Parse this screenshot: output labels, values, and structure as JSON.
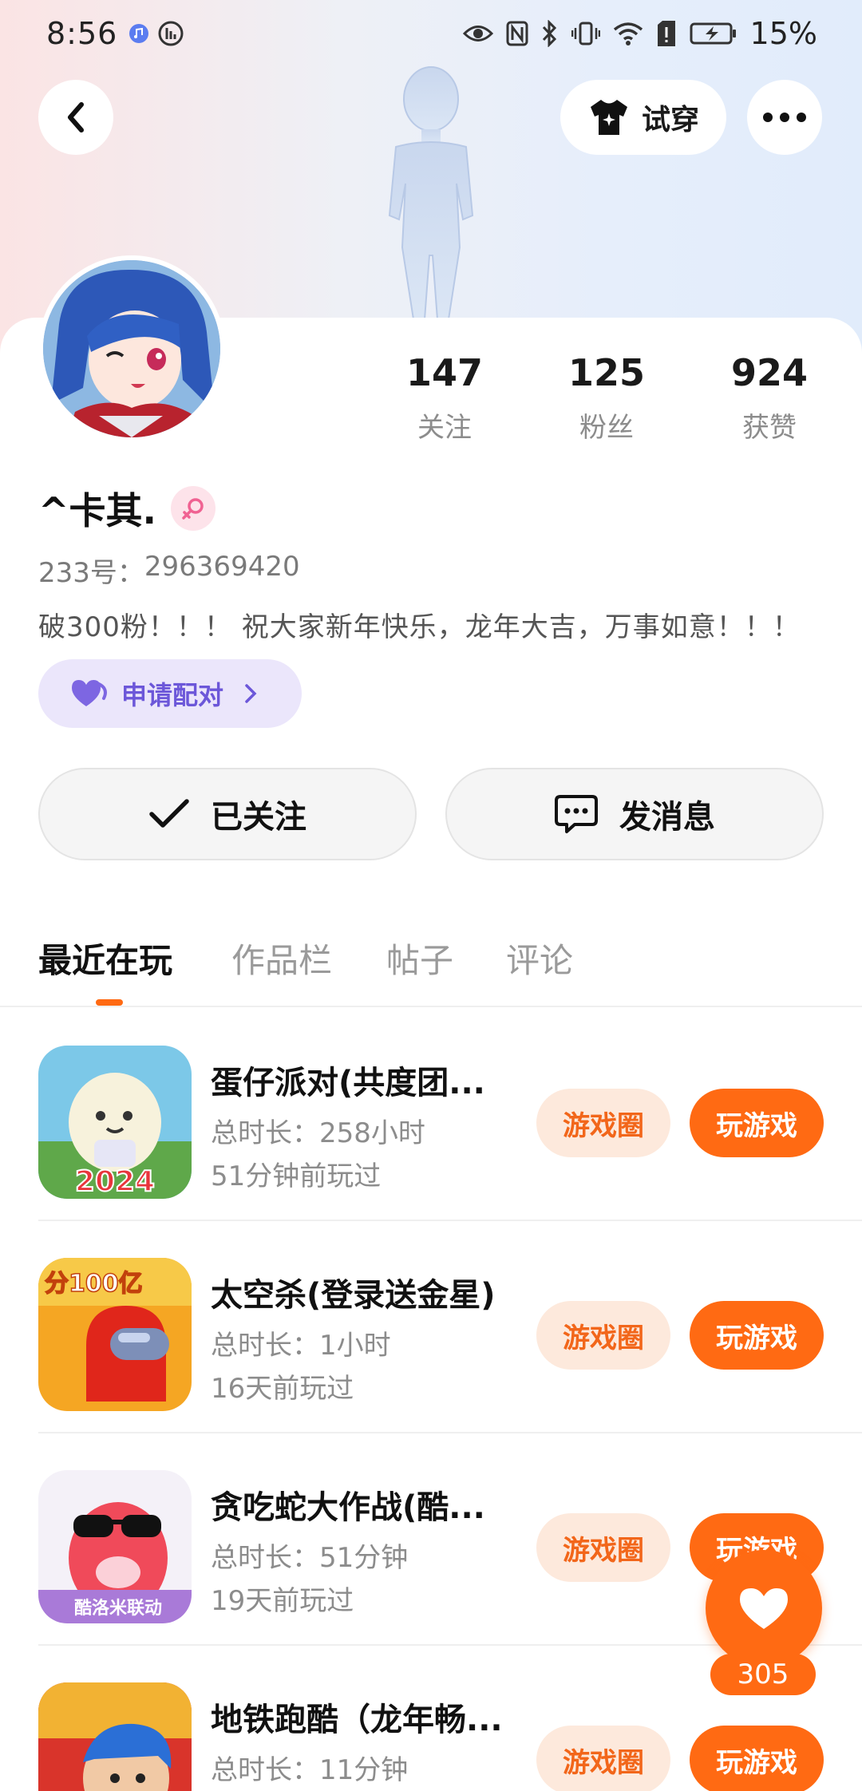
{
  "status_bar": {
    "time": "8:56",
    "battery": "15%"
  },
  "nav": {
    "try_on_label": "试穿"
  },
  "profile": {
    "stats": [
      {
        "num": "147",
        "label": "关注"
      },
      {
        "num": "125",
        "label": "粉丝"
      },
      {
        "num": "924",
        "label": "获赞"
      }
    ],
    "nickname": "^卡其.",
    "uid_label": "233号：",
    "uid": "296369420",
    "bio": "破300粉！！！ 祝大家新年快乐，龙年大吉，万事如意！！！",
    "pair_label": "申请配对"
  },
  "actions": {
    "follow_label": "已关注",
    "message_label": "发消息"
  },
  "tabs": [
    {
      "label": "最近在玩"
    },
    {
      "label": "作品栏"
    },
    {
      "label": "帖子"
    },
    {
      "label": "评论"
    }
  ],
  "games": [
    {
      "name": "蛋仔派对(共度团...",
      "duration": "总时长：258小时",
      "last_played": "51分钟前玩过",
      "circle_label": "游戏圈",
      "play_label": "玩游戏"
    },
    {
      "name": "太空杀(登录送金星)",
      "duration": "总时长：1小时",
      "last_played": "16天前玩过",
      "circle_label": "游戏圈",
      "play_label": "玩游戏"
    },
    {
      "name": "贪吃蛇大作战(酷...",
      "duration": "总时长：51分钟",
      "last_played": "19天前玩过",
      "circle_label": "游戏圈",
      "play_label": "玩游戏"
    },
    {
      "name": "地铁跑酷（龙年畅...",
      "duration": "总时长：11分钟",
      "last_played": "",
      "circle_label": "游戏圈",
      "play_label": "玩游戏"
    }
  ],
  "game_icon_texts": {
    "egg": "2024",
    "space": "分100亿",
    "snake": "酷洛米联动"
  },
  "like": {
    "count": "305"
  },
  "colors": {
    "accent": "#ff6a13",
    "accent_soft": "#fde9dc",
    "pair": "#6c57d9"
  }
}
